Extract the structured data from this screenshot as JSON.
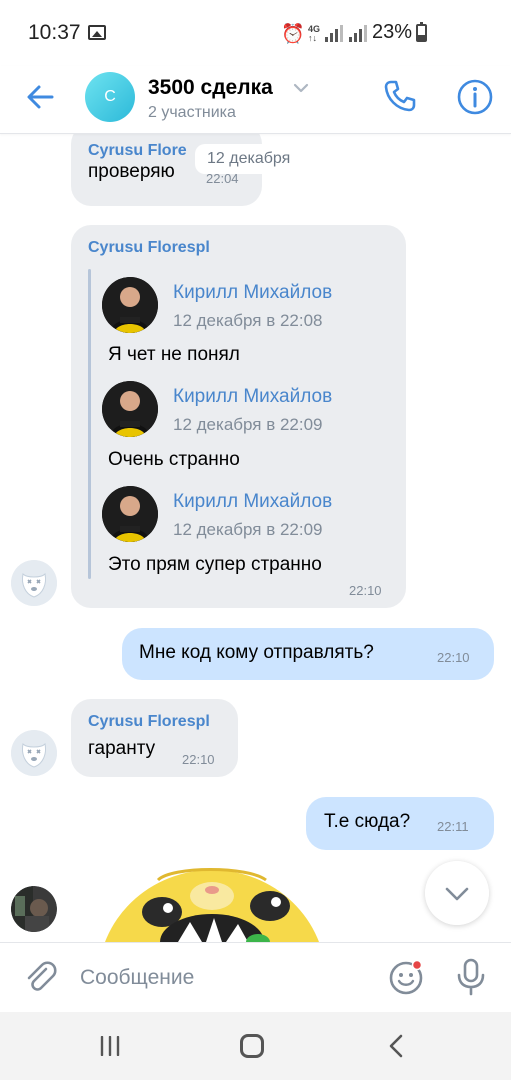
{
  "status_bar": {
    "time": "10:37",
    "network": "4G",
    "battery": "23%"
  },
  "header": {
    "avatar_letter": "C",
    "title": "3500 сделка",
    "subtitle": "2 участника"
  },
  "messages": {
    "m1": {
      "sender": "Cyrusu Flore",
      "date_pill": "12 декабря",
      "text": "проверяю",
      "time": "22:04"
    },
    "m2": {
      "sender": "Cyrusu Florespl",
      "forwarded": [
        {
          "name": "Кирилл Михайлов",
          "date": "12 декабря в 22:08",
          "text": "Я чет не понял"
        },
        {
          "name": "Кирилл Михайлов",
          "date": "12 декабря в 22:09",
          "text": "Очень странно"
        },
        {
          "name": "Кирилл Михайлов",
          "date": "12 декабря в 22:09",
          "text": "Это прям супер странно"
        }
      ],
      "time": "22:10"
    },
    "m3": {
      "text": "Мне код кому отправлять?",
      "time": "22:10"
    },
    "m4": {
      "sender": "Cyrusu Florespl",
      "text": "гаранту",
      "time": "22:10"
    },
    "m5": {
      "text": "Т.е сюда?",
      "time": "22:11"
    }
  },
  "composer": {
    "placeholder": "Сообщение"
  },
  "colors": {
    "accent": "#3f8ae0",
    "incoming_bubble": "#ebedf0",
    "outgoing_bubble": "#cce4ff",
    "sender_name": "#4986cc",
    "sticker_yellow": "#f6d94a"
  }
}
